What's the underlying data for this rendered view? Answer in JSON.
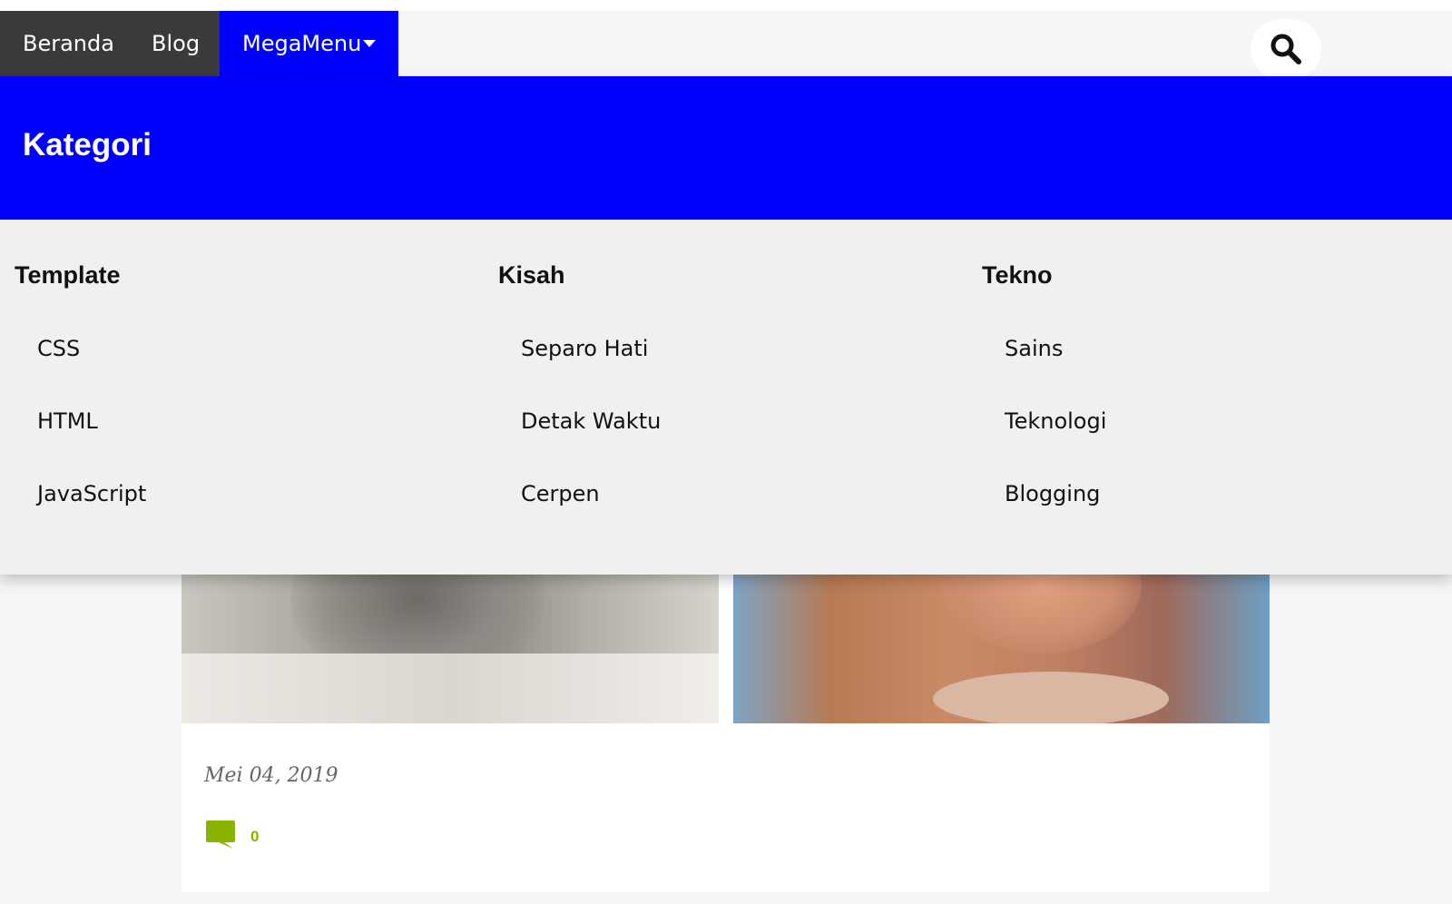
{
  "nav": {
    "items": [
      "Beranda",
      "Blog"
    ],
    "megamenu_label": "MegaMenu"
  },
  "icons": {
    "search": "search-icon",
    "caret": "caret-down-icon",
    "comment": "comment-icon"
  },
  "colors": {
    "accent": "#0000ff",
    "nav_dark": "#3a3a3a",
    "comment_green": "#88b300"
  },
  "megamenu": {
    "title": "Kategori",
    "columns": [
      {
        "heading": "Template",
        "links": [
          "CSS",
          "HTML",
          "JavaScript"
        ]
      },
      {
        "heading": "Kisah",
        "links": [
          "Separo Hati",
          "Detak Waktu",
          "Cerpen"
        ]
      },
      {
        "heading": "Tekno",
        "links": [
          "Sains",
          "Teknologi",
          "Blogging"
        ]
      }
    ]
  },
  "post": {
    "date": "Mei 04, 2019",
    "comment_count": "0"
  }
}
